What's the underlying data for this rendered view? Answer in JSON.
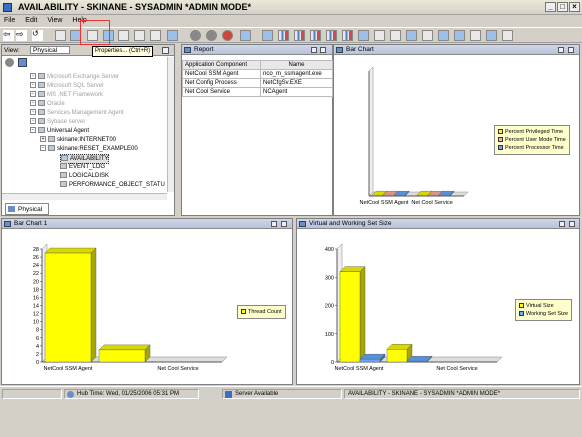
{
  "window": {
    "title": "AVAILABILITY - SKINANE - SYSADMIN   *ADMIN MODE*"
  },
  "menu": [
    "File",
    "Edit",
    "View",
    "Help"
  ],
  "tooltip": "Properties... (Ctrl+R)",
  "navigator": {
    "title": "View:",
    "view_value": "Physical",
    "items": [
      {
        "label": "Microsoft Exchange Server",
        "disabled": true
      },
      {
        "label": "Microsoft SQL Server",
        "disabled": true
      },
      {
        "label": "MS .NET Framework",
        "disabled": true
      },
      {
        "label": "Oracle",
        "disabled": true
      },
      {
        "label": "Services Management Agent",
        "disabled": true
      },
      {
        "label": "Sybase server",
        "disabled": true
      },
      {
        "label": "Universal Agent",
        "disabled": false
      },
      {
        "label": "skinane:INTERNET00",
        "disabled": false
      },
      {
        "label": "skinane:RESET_EXAMPLE00",
        "disabled": false
      },
      {
        "label": "AVAILABILITY",
        "disabled": false
      },
      {
        "label": "EVENT_LOG",
        "disabled": false
      },
      {
        "label": "LOGICALDISK",
        "disabled": false
      },
      {
        "label": "PERFORMANCE_OBJECT_STATU",
        "disabled": false
      }
    ],
    "tab": "Physical"
  },
  "report": {
    "title": "Report",
    "columns": [
      "Application Component",
      "Name"
    ],
    "rows": [
      [
        "NetCool SSM Agent",
        "nco_m_ssmagent.exe"
      ],
      [
        "Net Config Process",
        "NetCfgSv.EXE"
      ],
      [
        "Net Cool Service",
        "NCAgent"
      ]
    ]
  },
  "panels": {
    "bar_chart_top": "Bar Chart",
    "bar_chart_1": "Bar Chart 1",
    "virtual": "Virtual and Working Set Size"
  },
  "chart_data": [
    {
      "type": "bar",
      "categories": [
        "NetCool SSM Agent",
        "Net Cool Service"
      ],
      "series": [
        {
          "name": "Percent Privileged Time",
          "values": [
            0,
            0
          ]
        },
        {
          "name": "Percent User Mode Time",
          "values": [
            0,
            0
          ]
        },
        {
          "name": "Percent Processor Time",
          "values": [
            0,
            0
          ]
        }
      ],
      "colors": [
        "#ffff00",
        "#ffb0a0",
        "#66aaff"
      ]
    },
    {
      "type": "bar",
      "categories": [
        "NetCool SSM Agent",
        "Net Cool Service"
      ],
      "series": [
        {
          "name": "Thread Count",
          "values": [
            27,
            3
          ]
        }
      ],
      "ylim": [
        0,
        28
      ],
      "yticks": [
        0,
        2,
        4,
        6,
        8,
        10,
        12,
        14,
        16,
        18,
        20,
        22,
        24,
        26,
        28
      ],
      "colors": [
        "#ffff00"
      ]
    },
    {
      "type": "bar",
      "categories": [
        "NetCool SSM Agent",
        "Net Cool Service"
      ],
      "series": [
        {
          "name": "Virtual Size",
          "values": [
            320,
            45
          ]
        },
        {
          "name": "Working Set Size",
          "values": [
            10,
            0
          ]
        }
      ],
      "ylim": [
        0,
        400
      ],
      "yticks": [
        0,
        100,
        200,
        300,
        400
      ],
      "colors": [
        "#ffff00",
        "#66aaff"
      ]
    }
  ],
  "status": {
    "hub_time": "Hub Time: Wed, 01/25/2006 05:31 PM",
    "server": "Server Available",
    "workspace": "AVAILABILITY - SKINANE - SYSADMIN *ADMIN MODE*"
  }
}
